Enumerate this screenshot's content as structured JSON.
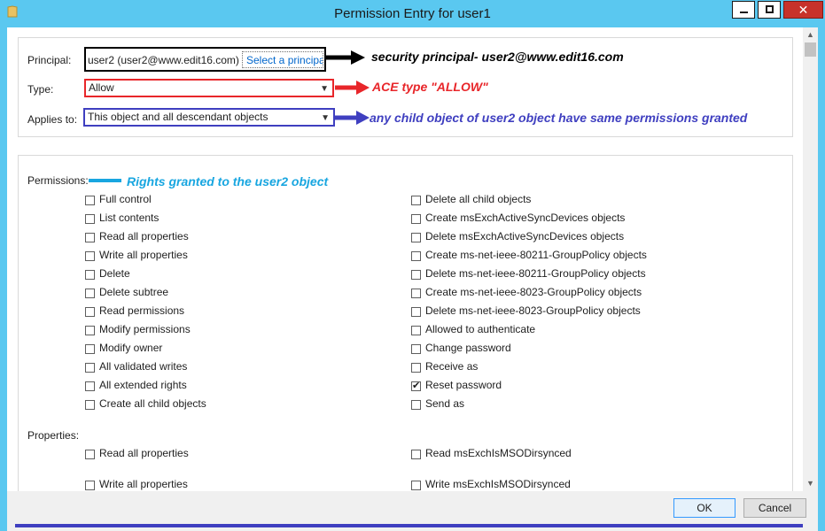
{
  "window": {
    "title": "Permission Entry for user1",
    "icons": {
      "app": "folder-icon",
      "minimize": "minimize-icon",
      "maximize": "maximize-icon",
      "close": "close-icon"
    }
  },
  "principal": {
    "label": "Principal:",
    "value": "user2 (user2@www.edit16.com)",
    "link": "Select a principa",
    "annotation": "security principal- user2@www.edit16.com"
  },
  "type": {
    "label": "Type:",
    "value": "Allow",
    "annotation": "ACE type \"ALLOW\""
  },
  "applies_to": {
    "label": "Applies to:",
    "value": "This object and all descendant objects",
    "annotation": "any child object of user2 object have same permissions granted"
  },
  "permissions": {
    "label": "Permissions:",
    "annotation": "Rights granted to the user2 object",
    "left": [
      {
        "label": "Full control",
        "checked": false
      },
      {
        "label": "List contents",
        "checked": false
      },
      {
        "label": "Read all properties",
        "checked": false
      },
      {
        "label": "Write all properties",
        "checked": false
      },
      {
        "label": "Delete",
        "checked": false
      },
      {
        "label": "Delete subtree",
        "checked": false
      },
      {
        "label": "Read permissions",
        "checked": false
      },
      {
        "label": "Modify permissions",
        "checked": false
      },
      {
        "label": "Modify owner",
        "checked": false
      },
      {
        "label": "All validated writes",
        "checked": false
      },
      {
        "label": "All extended rights",
        "checked": false
      },
      {
        "label": "Create all child objects",
        "checked": false
      }
    ],
    "right": [
      {
        "label": "Delete all child objects",
        "checked": false
      },
      {
        "label": "Create msExchActiveSyncDevices objects",
        "checked": false
      },
      {
        "label": "Delete msExchActiveSyncDevices objects",
        "checked": false
      },
      {
        "label": "Create ms-net-ieee-80211-GroupPolicy objects",
        "checked": false
      },
      {
        "label": "Delete ms-net-ieee-80211-GroupPolicy objects",
        "checked": false
      },
      {
        "label": "Create ms-net-ieee-8023-GroupPolicy objects",
        "checked": false
      },
      {
        "label": "Delete ms-net-ieee-8023-GroupPolicy objects",
        "checked": false
      },
      {
        "label": "Allowed to authenticate",
        "checked": false
      },
      {
        "label": "Change password",
        "checked": false
      },
      {
        "label": "Receive as",
        "checked": false
      },
      {
        "label": "Reset password",
        "checked": true
      },
      {
        "label": "Send as",
        "checked": false
      }
    ]
  },
  "properties": {
    "label": "Properties:",
    "left": [
      {
        "label": "Read all properties",
        "checked": false
      },
      {
        "label": "Write all properties",
        "checked": false
      }
    ],
    "right": [
      {
        "label": "Read msExchIsMSODirsynced",
        "checked": false
      },
      {
        "label": "Write msExchIsMSODirsynced",
        "checked": false
      }
    ]
  },
  "buttons": {
    "ok": "OK",
    "cancel": "Cancel"
  },
  "colors": {
    "titlebar": "#5ac8f0",
    "annotation_black": "#000000",
    "annotation_red": "#e8262a",
    "annotation_blue": "#3f3fc0",
    "annotation_cyan": "#18a6e0"
  }
}
